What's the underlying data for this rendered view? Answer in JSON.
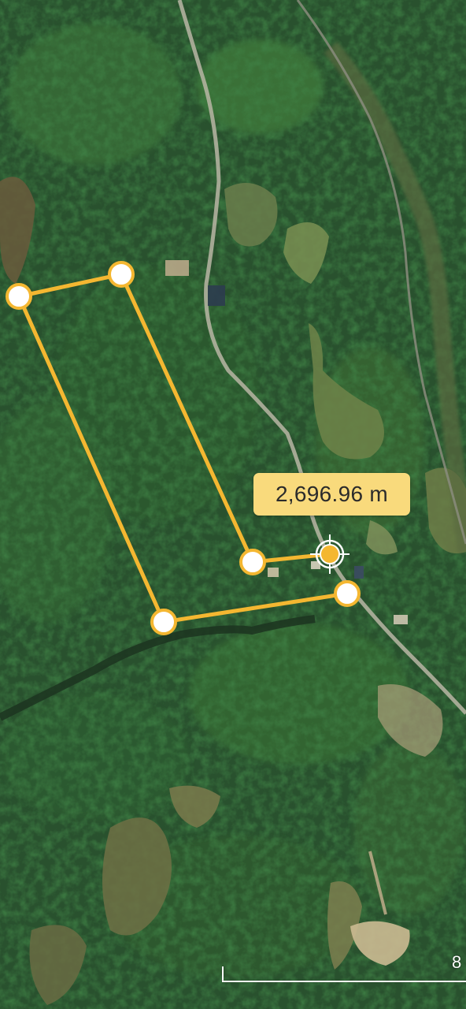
{
  "map": {
    "type": "satellite",
    "accent_color": "#f4b731",
    "vertex_fill": "#ffffff",
    "label_color": "#f9da7c"
  },
  "measurement": {
    "distance_label": "2,696.96 m",
    "vertex_count": 6,
    "crosshair_icon": "crosshair-icon"
  },
  "scale": {
    "label": "8"
  }
}
